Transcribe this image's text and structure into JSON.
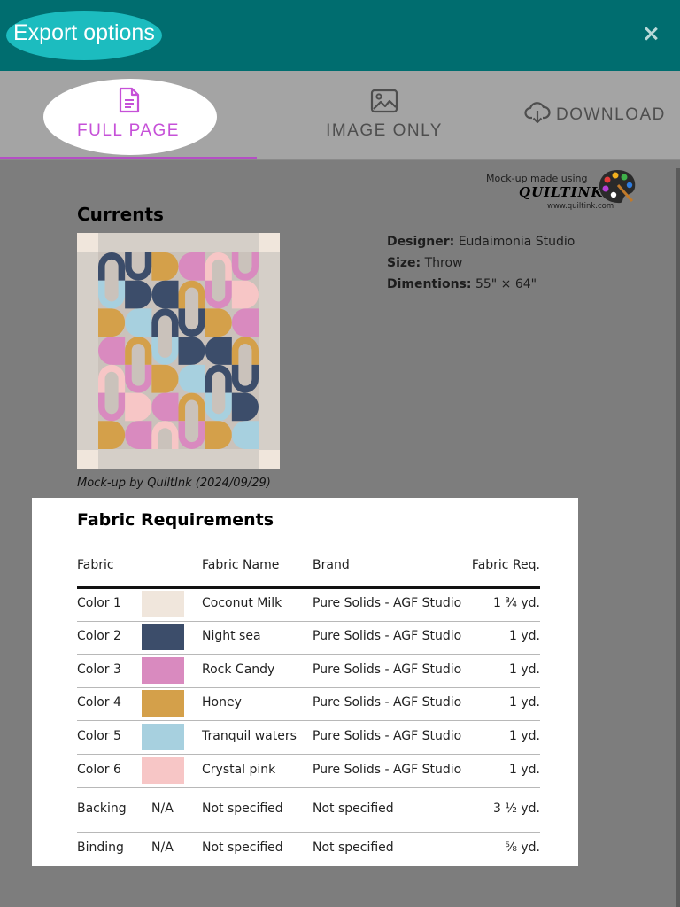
{
  "header": {
    "title": "Export options",
    "close_icon": "close-icon"
  },
  "tabs": [
    {
      "label": "FULL PAGE",
      "icon": "document-icon",
      "active": true,
      "color": "#c651d8"
    },
    {
      "label": "IMAGE ONLY",
      "icon": "image-icon",
      "active": false
    },
    {
      "label": "DOWNLOAD",
      "icon": "cloud-download-icon",
      "active": false
    }
  ],
  "brand": {
    "made_using": "Mock-up made using",
    "logo_text": "QUILTINK",
    "url": "www.quiltink.com",
    "logo_icon": "paint-palette-icon"
  },
  "quilt": {
    "title": "Currents",
    "caption": "Mock-up by QuiltInk (2024/09/29)",
    "designer_label": "Designer:",
    "designer": "Eudaimonia Studio",
    "size_label": "Size:",
    "size": "Throw",
    "dimensions_label": "Dimentions:",
    "dimensions": "55\" × 64\""
  },
  "requirements": {
    "title": "Fabric Requirements",
    "columns": [
      "Fabric",
      "Fabric Name",
      "Brand",
      "Fabric Req."
    ],
    "rows": [
      {
        "fabric": "Color 1",
        "swatch": "#f0e6dc",
        "name": "Coconut Milk",
        "brand": "Pure Solids - AGF Studio",
        "req": "1 ¾ yd."
      },
      {
        "fabric": "Color 2",
        "swatch": "#3c4d6a",
        "name": "Night sea",
        "brand": "Pure Solids - AGF Studio",
        "req": "1 yd."
      },
      {
        "fabric": "Color 3",
        "swatch": "#d98abf",
        "name": "Rock Candy",
        "brand": "Pure Solids - AGF Studio",
        "req": "1 yd."
      },
      {
        "fabric": "Color 4",
        "swatch": "#d4a04a",
        "name": "Honey",
        "brand": "Pure Solids - AGF Studio",
        "req": "1 yd."
      },
      {
        "fabric": "Color 5",
        "swatch": "#a7d0df",
        "name": "Tranquil waters",
        "brand": "Pure Solids - AGF Studio",
        "req": "1 yd."
      },
      {
        "fabric": "Color 6",
        "swatch": "#f7c6c6",
        "name": "Crystal pink",
        "brand": "Pure Solids - AGF Studio",
        "req": "1 yd."
      }
    ],
    "extras": [
      {
        "fabric": "Backing",
        "swatch_text": "N/A",
        "name": "Not specified",
        "brand": "Not specified",
        "req": "3 ½ yd."
      },
      {
        "fabric": "Binding",
        "swatch_text": "N/A",
        "name": "Not specified",
        "brand": "Not specified",
        "req": "⅝ yd."
      }
    ]
  }
}
